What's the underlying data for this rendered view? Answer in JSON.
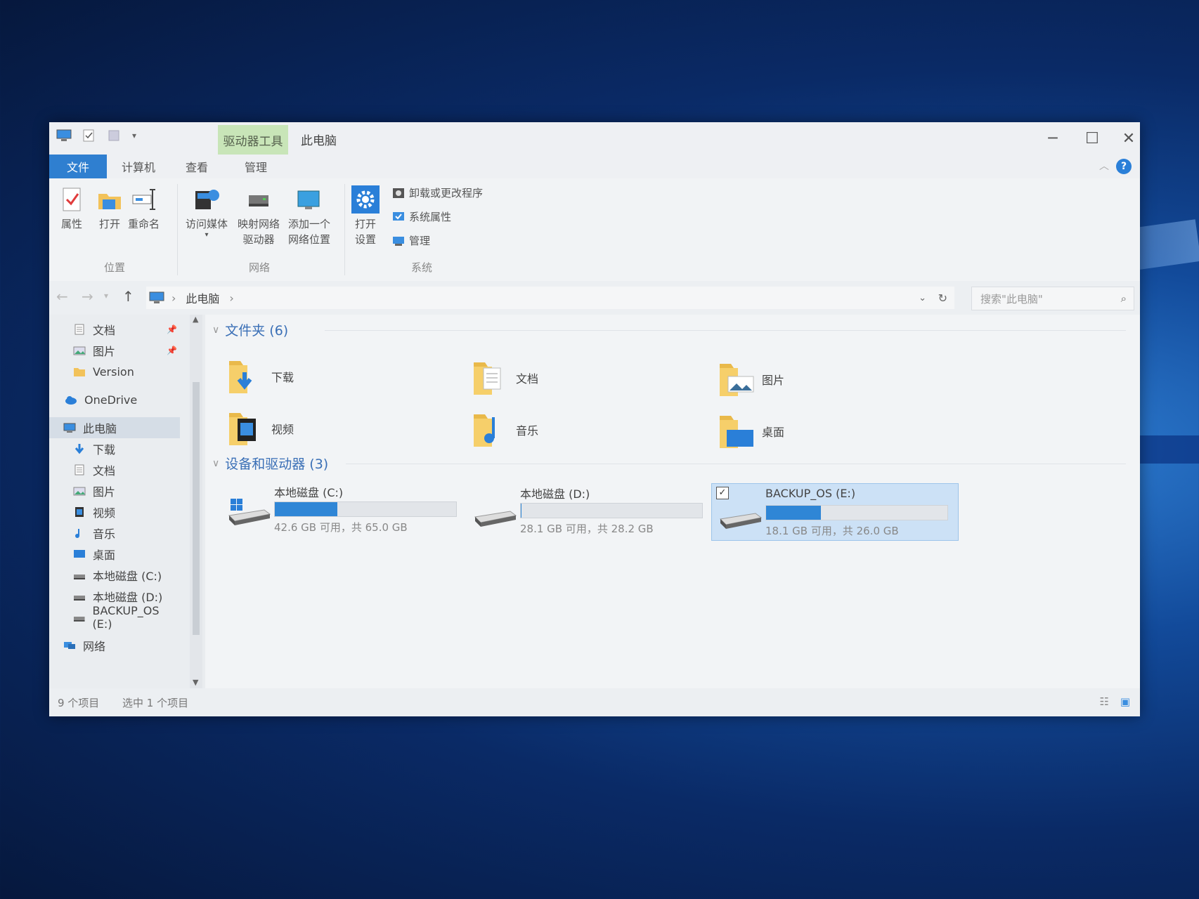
{
  "window": {
    "title": "此电脑",
    "context_tab": "驱动器工具",
    "minimize": "─",
    "maximize": "☐",
    "close": "✕"
  },
  "ribbon_tabs": [
    "文件",
    "计算机",
    "查看",
    "管理"
  ],
  "ribbon": {
    "location": {
      "group": "位置",
      "properties": "属性",
      "open": "打开",
      "rename": "重命名"
    },
    "network": {
      "group": "网络",
      "media": "访问媒体",
      "map_drive_1": "映射网络",
      "map_drive_2": "驱动器",
      "add_loc_1": "添加一个",
      "add_loc_2": "网络位置"
    },
    "system": {
      "group": "系统",
      "open_settings_1": "打开",
      "open_settings_2": "设置",
      "uninstall": "卸载或更改程序",
      "sys_props": "系统属性",
      "manage": "管理"
    }
  },
  "address": {
    "crumb": "此电脑",
    "search_placeholder": "搜索\"此电脑\""
  },
  "nav": [
    {
      "label": "文档",
      "icon": "document-icon",
      "pinned": true
    },
    {
      "label": "图片",
      "icon": "picture-icon",
      "pinned": true
    },
    {
      "label": "Version",
      "icon": "folder-icon"
    },
    {
      "label": "OneDrive",
      "icon": "cloud-icon"
    },
    {
      "label": "此电脑",
      "icon": "computer-icon",
      "selected": true
    },
    {
      "label": "下载",
      "icon": "download-icon"
    },
    {
      "label": "文档",
      "icon": "document-icon"
    },
    {
      "label": "图片",
      "icon": "picture-icon"
    },
    {
      "label": "视频",
      "icon": "video-icon"
    },
    {
      "label": "音乐",
      "icon": "music-icon"
    },
    {
      "label": "桌面",
      "icon": "desktop-icon"
    },
    {
      "label": "本地磁盘 (C:)",
      "icon": "drive-icon"
    },
    {
      "label": "本地磁盘 (D:)",
      "icon": "drive-icon"
    },
    {
      "label": "BACKUP_OS (E:)",
      "icon": "drive-icon"
    },
    {
      "label": "网络",
      "icon": "network-icon"
    }
  ],
  "folders_header": "文件夹 (6)",
  "folders": [
    {
      "label": "下载",
      "icon": "download-folder-icon"
    },
    {
      "label": "文档",
      "icon": "documents-folder-icon"
    },
    {
      "label": "图片",
      "icon": "pictures-folder-icon"
    },
    {
      "label": "视频",
      "icon": "videos-folder-icon"
    },
    {
      "label": "音乐",
      "icon": "music-folder-icon"
    },
    {
      "label": "桌面",
      "icon": "desktop-folder-icon"
    }
  ],
  "drives_header": "设备和驱动器 (3)",
  "drives": [
    {
      "name": "本地磁盘 (C:)",
      "info": "42.6 GB 可用，共 65.0 GB",
      "used_fraction": 0.345,
      "selected": false
    },
    {
      "name": "本地磁盘 (D:)",
      "info": "28.1 GB 可用，共 28.2 GB",
      "used_fraction": 0.004,
      "selected": true
    },
    {
      "name": "BACKUP_OS (E:)",
      "info": "18.1 GB 可用，共 26.0 GB",
      "used_fraction": 0.304,
      "selected": true
    }
  ],
  "status": {
    "count": "9 个项目",
    "selection": "选中 1 个项目"
  },
  "colors": {
    "accent": "#2f7fd0",
    "drive_fill": "#2f86d6",
    "context_tab": "#c8e5b8"
  }
}
